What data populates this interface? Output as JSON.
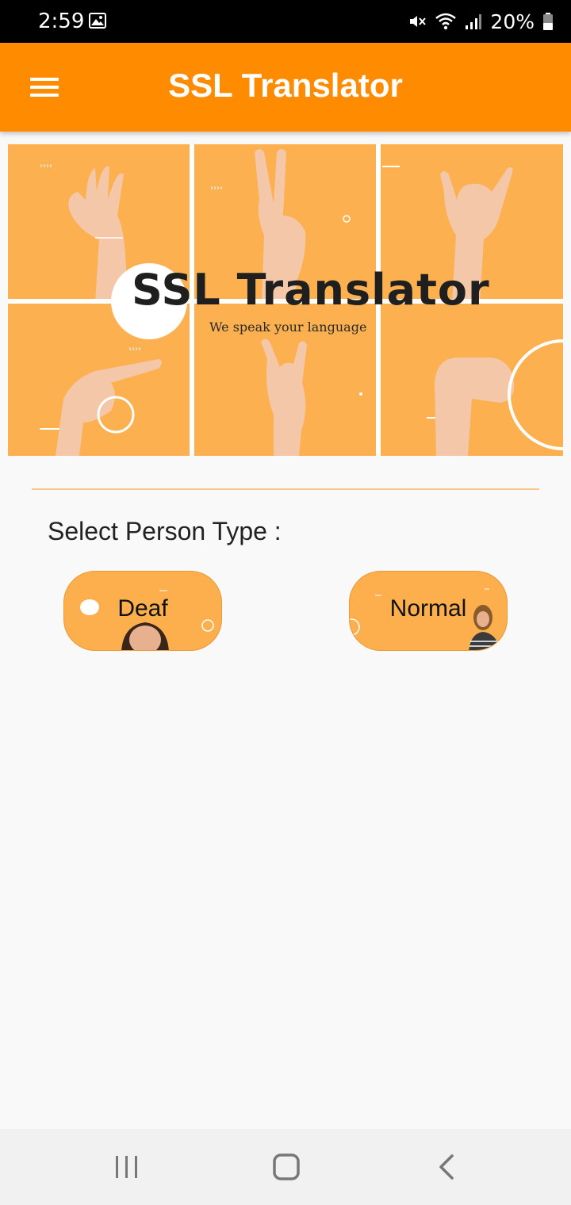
{
  "status_bar": {
    "time": "2:59",
    "battery": "20%",
    "icons": [
      "gallery-icon",
      "mute-icon",
      "wifi-icon",
      "signal-icon",
      "battery-icon"
    ]
  },
  "app_bar": {
    "title": "SSL Translator",
    "menu_icon": "hamburger-menu-icon"
  },
  "banner": {
    "title": "SSL Translator",
    "subtitle": "We speak your language"
  },
  "main": {
    "section_label": "Select Person Type :",
    "options": [
      {
        "label": "Deaf"
      },
      {
        "label": "Normal"
      }
    ]
  },
  "nav_bar": {
    "icons": [
      "recent-apps-icon",
      "home-icon",
      "back-icon"
    ]
  },
  "colors": {
    "accent": "#ff8c00",
    "banner_panel": "#fcb04f",
    "button_fill": "#fdaf4d",
    "divider": "#fbc88a"
  }
}
